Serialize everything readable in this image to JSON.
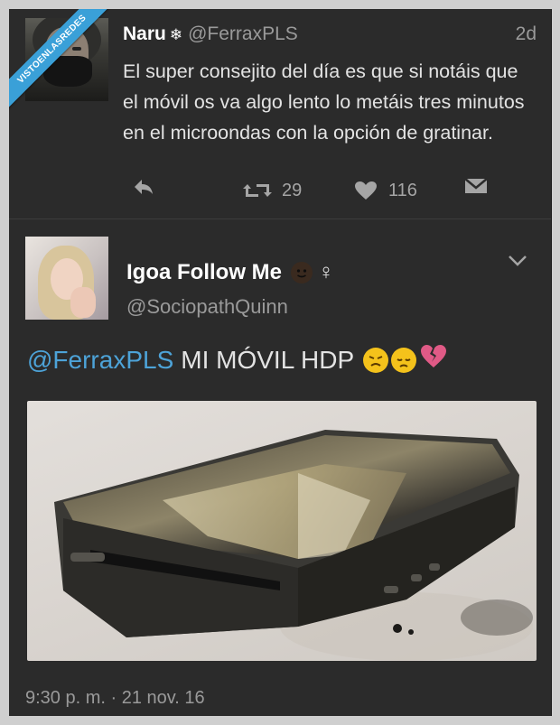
{
  "watermark": "VISTOENLASREDES",
  "tweet1": {
    "name": "Naru",
    "badge_icon": "snowflake-icon",
    "handle": "@FerraxPLS",
    "time": "2d",
    "text": "El super consejito del día es que si notáis que el móvil os va algo lento lo metáis tres minutos en el microondas con la opción de gratinar.",
    "retweets": "29",
    "likes": "116"
  },
  "tweet2": {
    "name": "Igoa Follow Me",
    "handle": "@SociopathQuinn",
    "mention": "@FerraxPLS",
    "text": "MI MÓVIL HDP",
    "emojis": [
      "angry-face-icon",
      "sad-face-icon",
      "broken-heart-icon"
    ],
    "timestamp": "9:30 p. m. · 21 nov. 16"
  },
  "colors": {
    "background": "#2b2b2b",
    "text": "#e3e3e3",
    "muted": "#9a9a9a",
    "link": "#4da3d8",
    "watermark": "#3aa0d8"
  }
}
